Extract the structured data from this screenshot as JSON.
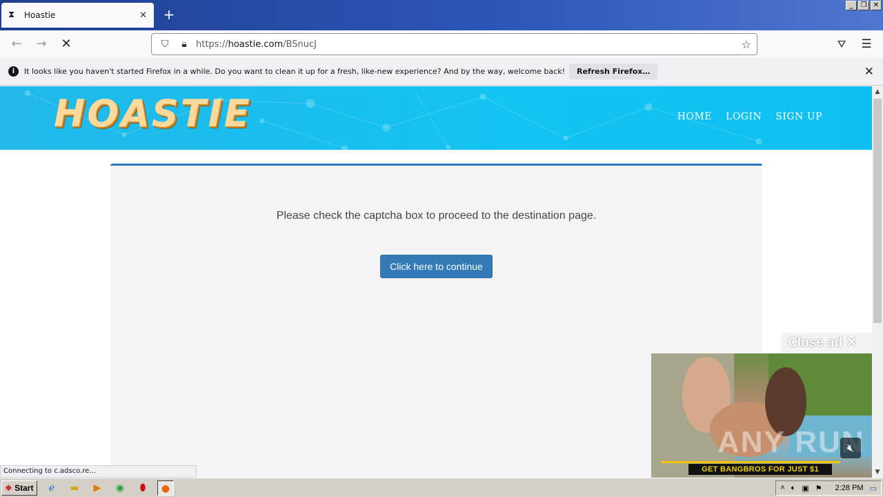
{
  "browser": {
    "tab_title": "Hoastie",
    "url_prefix": "https://",
    "url_host": "hoastie.com",
    "url_path": "/BSnucJ",
    "notification_text": "It looks like you haven't started Firefox in a while. Do you want to clean it up for a fresh, like-new experience? And by the way, welcome back!",
    "notification_button": "Refresh Firefox…",
    "status_text": "Connecting to c.adsco.re…"
  },
  "site": {
    "logo": "HOASTIE",
    "nav": [
      "HOME",
      "LOGIN",
      "SIGN UP"
    ],
    "message": "Please check the captcha box to proceed to the destination page.",
    "continue_button": "Click here to continue"
  },
  "ad": {
    "close_label": "Close ad ✕",
    "watermark": "ANY RUN",
    "banner": "GET BANGBROS FOR JUST $1"
  },
  "taskbar": {
    "start_label": "Start",
    "time": "2:28 PM"
  },
  "colors": {
    "header_blue": "#13c4f2",
    "button_blue": "#337ab7",
    "panel_border": "#2a74c0",
    "logo_color": "#fbd99a"
  }
}
